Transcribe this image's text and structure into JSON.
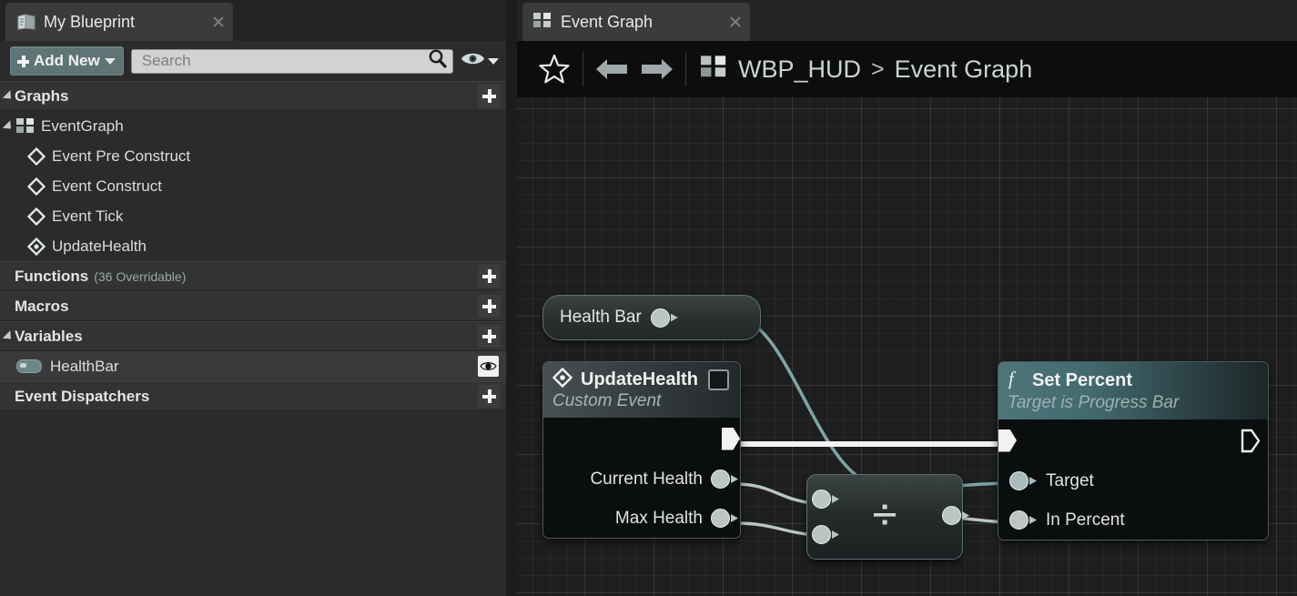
{
  "left_panel": {
    "tab": {
      "label": "My Blueprint",
      "icon": "blueprint-icon",
      "close_icon": "close-icon"
    },
    "toolbar": {
      "add_new_label": "Add New",
      "add_new_icon": "plus-icon",
      "add_new_caret": "chevron-down-icon",
      "search_placeholder": "Search",
      "search_value": "",
      "search_icon": "search-icon",
      "visibility_icon": "eye-icon",
      "visibility_caret": "chevron-down-icon"
    },
    "sections": [
      {
        "title": "Graphs",
        "subtitle": "",
        "expanded": true,
        "add_icon": "plus-icon",
        "items": [
          {
            "label": "EventGraph",
            "icon": "graph-icon",
            "indent": 0,
            "selected": false
          },
          {
            "label": "Event Pre Construct",
            "icon": "event-diamond-icon",
            "indent": 1,
            "selected": false
          },
          {
            "label": "Event Construct",
            "icon": "event-diamond-icon",
            "indent": 1,
            "selected": false
          },
          {
            "label": "Event Tick",
            "icon": "event-diamond-icon",
            "indent": 1,
            "selected": false
          },
          {
            "label": "UpdateHealth",
            "icon": "custom-event-diamond-icon",
            "indent": 1,
            "selected": false
          }
        ]
      },
      {
        "title": "Functions",
        "subtitle": "(36 Overridable)",
        "expanded": false,
        "add_icon": "plus-icon",
        "items": []
      },
      {
        "title": "Macros",
        "subtitle": "",
        "expanded": false,
        "add_icon": "plus-icon",
        "items": []
      },
      {
        "title": "Variables",
        "subtitle": "",
        "expanded": true,
        "add_icon": "plus-icon",
        "items": [
          {
            "label": "HealthBar",
            "icon": "object-pill-icon",
            "indent": 0,
            "selected": true,
            "eye_icon": "eye-icon"
          }
        ]
      },
      {
        "title": "Event Dispatchers",
        "subtitle": "",
        "expanded": false,
        "add_icon": "plus-icon",
        "items": []
      }
    ]
  },
  "graph_panel": {
    "tab": {
      "label": "Event Graph",
      "icon": "graph-icon",
      "close_icon": "close-icon"
    },
    "breadcrumb": {
      "favorite_icon": "star-icon",
      "back_icon": "arrow-left-icon",
      "forward_icon": "arrow-right-icon",
      "path_icon": "graph-icon",
      "root": "WBP_HUD",
      "separator": ">",
      "leaf": "Event Graph"
    },
    "nodes": {
      "health_bar_getter": {
        "title": "Health Bar",
        "pin_icon": "object-pin-icon"
      },
      "update_health": {
        "title": "UpdateHealth",
        "subtitle": "Custom Event",
        "title_icon": "custom-event-diamond-icon",
        "corner_icon": "collapse-box-icon",
        "exec_out_icon": "exec-pin-icon",
        "outputs": [
          "Current Health",
          "Max Health"
        ]
      },
      "divide": {
        "symbol": "÷",
        "input_count": 2,
        "output_count": 1
      },
      "set_percent": {
        "title": "Set Percent",
        "subtitle": "Target is Progress Bar",
        "title_icon": "function-f-icon",
        "exec_in_icon": "exec-pin-icon",
        "exec_out_icon": "exec-pin-icon",
        "inputs": [
          "Target",
          "In Percent"
        ]
      }
    }
  },
  "colors": {
    "accent_teal": "#5f7475",
    "function_title": "#4d757a",
    "wire_object": "#7fa3a3",
    "wire_exec": "#f2f2f2",
    "panel_bg": "#2b2b2b",
    "canvas_bg": "#1e1e1e"
  }
}
